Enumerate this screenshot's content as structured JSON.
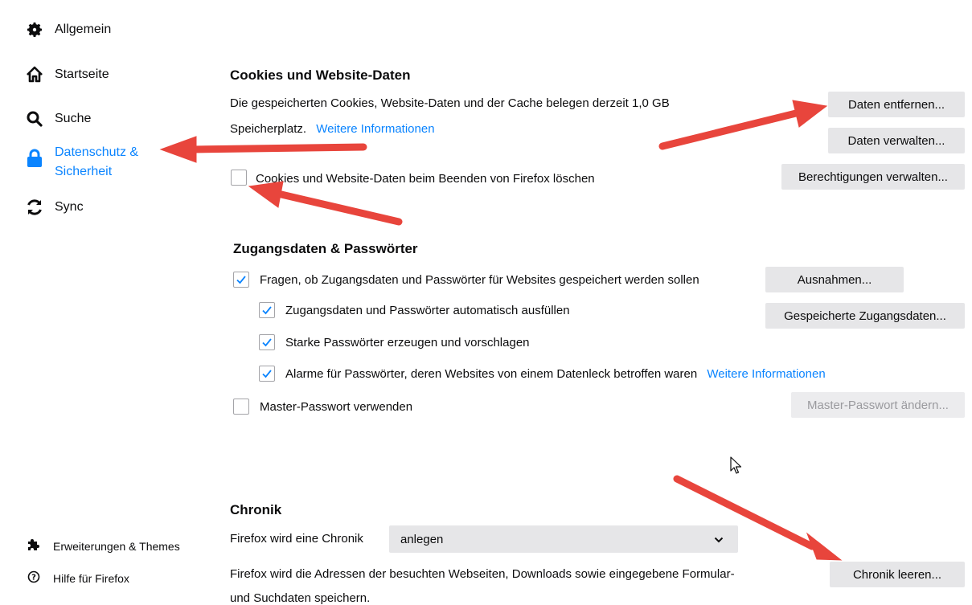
{
  "sidebar": {
    "items": [
      {
        "label": "Allgemein",
        "icon": "gear-icon"
      },
      {
        "label": "Startseite",
        "icon": "home-icon"
      },
      {
        "label": "Suche",
        "icon": "search-icon"
      },
      {
        "label_line1": "Datenschutz &",
        "label_line2": "Sicherheit",
        "icon": "lock-icon",
        "active": true
      },
      {
        "label": "Sync",
        "icon": "sync-icon"
      }
    ],
    "bottom": [
      {
        "label": "Erweiterungen & Themes",
        "icon": "puzzle-icon"
      },
      {
        "label": "Hilfe für Firefox",
        "icon": "help-icon"
      }
    ]
  },
  "cookies": {
    "heading": "Cookies und Website-Daten",
    "desc_line1": "Die gespeicherten Cookies, Website-Daten und der Cache belegen derzeit 1,0 GB",
    "desc_line2": "Speicherplatz.",
    "more_info": "Weitere Informationen",
    "delete_on_close_label": "Cookies und Website-Daten beim Beenden von Firefox löschen",
    "delete_on_close_checked": false,
    "btn_remove": "Daten entfernen...",
    "btn_manage": "Daten verwalten...",
    "btn_permissions": "Berechtigungen verwalten..."
  },
  "logins": {
    "heading": "Zugangsdaten & Passwörter",
    "ask_label": "Fragen, ob Zugangsdaten und Passwörter für Websites gespeichert werden sollen",
    "autofill_label": "Zugangsdaten und Passwörter automatisch ausfüllen",
    "suggest_label": "Starke Passwörter erzeugen und vorschlagen",
    "alerts_label": "Alarme für Passwörter, deren Websites von einem Datenleck betroffen waren",
    "alerts_more_info": "Weitere Informationen",
    "master_label": "Master-Passwort verwenden",
    "btn_exceptions": "Ausnahmen...",
    "btn_saved": "Gespeicherte Zugangsdaten...",
    "btn_master_change": "Master-Passwort ändern..."
  },
  "history": {
    "heading": "Chronik",
    "mode_label": "Firefox wird eine Chronik",
    "mode_value": "anlegen",
    "desc_line1": "Firefox wird die Adressen der besuchten Webseiten, Downloads sowie eingegebene Formular-",
    "desc_line2": "und Suchdaten speichern.",
    "btn_clear": "Chronik leeren..."
  },
  "colors": {
    "accent": "#0a84ff",
    "annotation_arrow": "#e8453c"
  }
}
